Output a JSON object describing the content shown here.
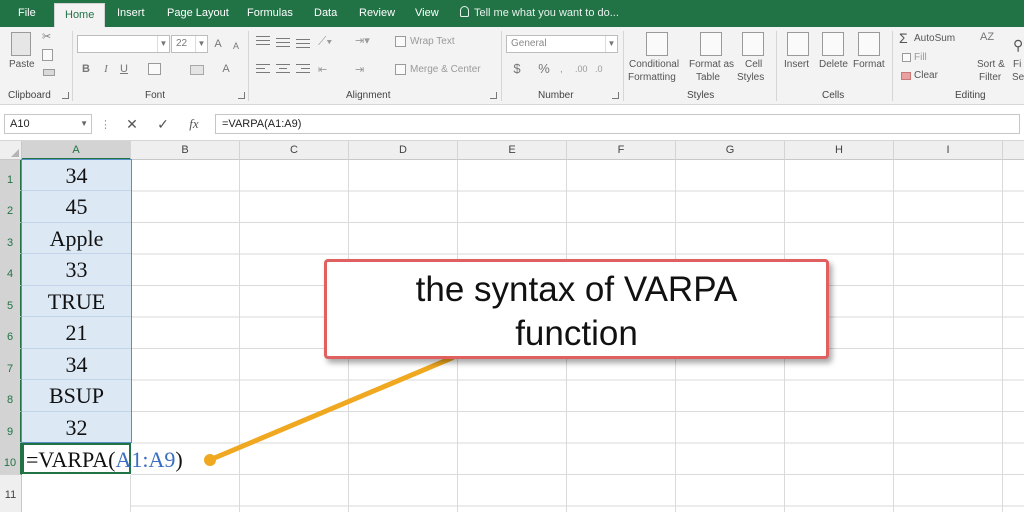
{
  "tabs": [
    "File",
    "Home",
    "Insert",
    "Page Layout",
    "Formulas",
    "Data",
    "Review",
    "View"
  ],
  "active_tab": "Home",
  "tell_me": "Tell me what you want to do...",
  "ribbon": {
    "clipboard": {
      "paste": "Paste",
      "label": "Clipboard"
    },
    "font": {
      "size": "22",
      "bold": "B",
      "italic": "I",
      "underline": "U",
      "grow": "A",
      "shrink": "A",
      "color": "A",
      "label": "Font"
    },
    "alignment": {
      "wrap": "Wrap Text",
      "merge": "Merge & Center",
      "label": "Alignment"
    },
    "number": {
      "format": "General",
      "currency": "$",
      "percent": "%",
      "label": "Number"
    },
    "styles": {
      "conditional_1": "Conditional",
      "conditional_2": "Formatting",
      "table_1": "Format as",
      "table_2": "Table",
      "cell_1": "Cell",
      "cell_2": "Styles",
      "label": "Styles"
    },
    "cells": {
      "insert": "Insert",
      "delete": "Delete",
      "format": "Format",
      "label": "Cells"
    },
    "editing": {
      "autosum": "AutoSum",
      "fill": "Fill",
      "clear": "Clear",
      "sort_1": "Sort &",
      "sort_2": "Filter",
      "find_1": "Fi",
      "find_2": "Sel",
      "label": "Editing"
    }
  },
  "formula_bar": {
    "name_box": "A10",
    "cancel": "✕",
    "enter": "✓",
    "fx": "fx",
    "formula": "=VARPA(A1:A9)"
  },
  "columns": [
    "A",
    "B",
    "C",
    "D",
    "E",
    "F",
    "G",
    "H",
    "I"
  ],
  "rows": [
    "1",
    "2",
    "3",
    "4",
    "5",
    "6",
    "7",
    "8",
    "9",
    "10",
    "11"
  ],
  "cells_a": [
    "34",
    "45",
    "Apple",
    "33",
    "TRUE",
    "21",
    "34",
    "BSUP",
    "32"
  ],
  "formula_cell": {
    "prefix": "=VARPA(",
    "ref": "A1:A9",
    "suffix": ")"
  },
  "callout": {
    "line1": "the syntax of VARPA",
    "line2": "function"
  },
  "colors": {
    "accent": "#217346",
    "callout_border": "#e06060",
    "arrow": "#f0a820",
    "reference": "#3a6fbf"
  }
}
